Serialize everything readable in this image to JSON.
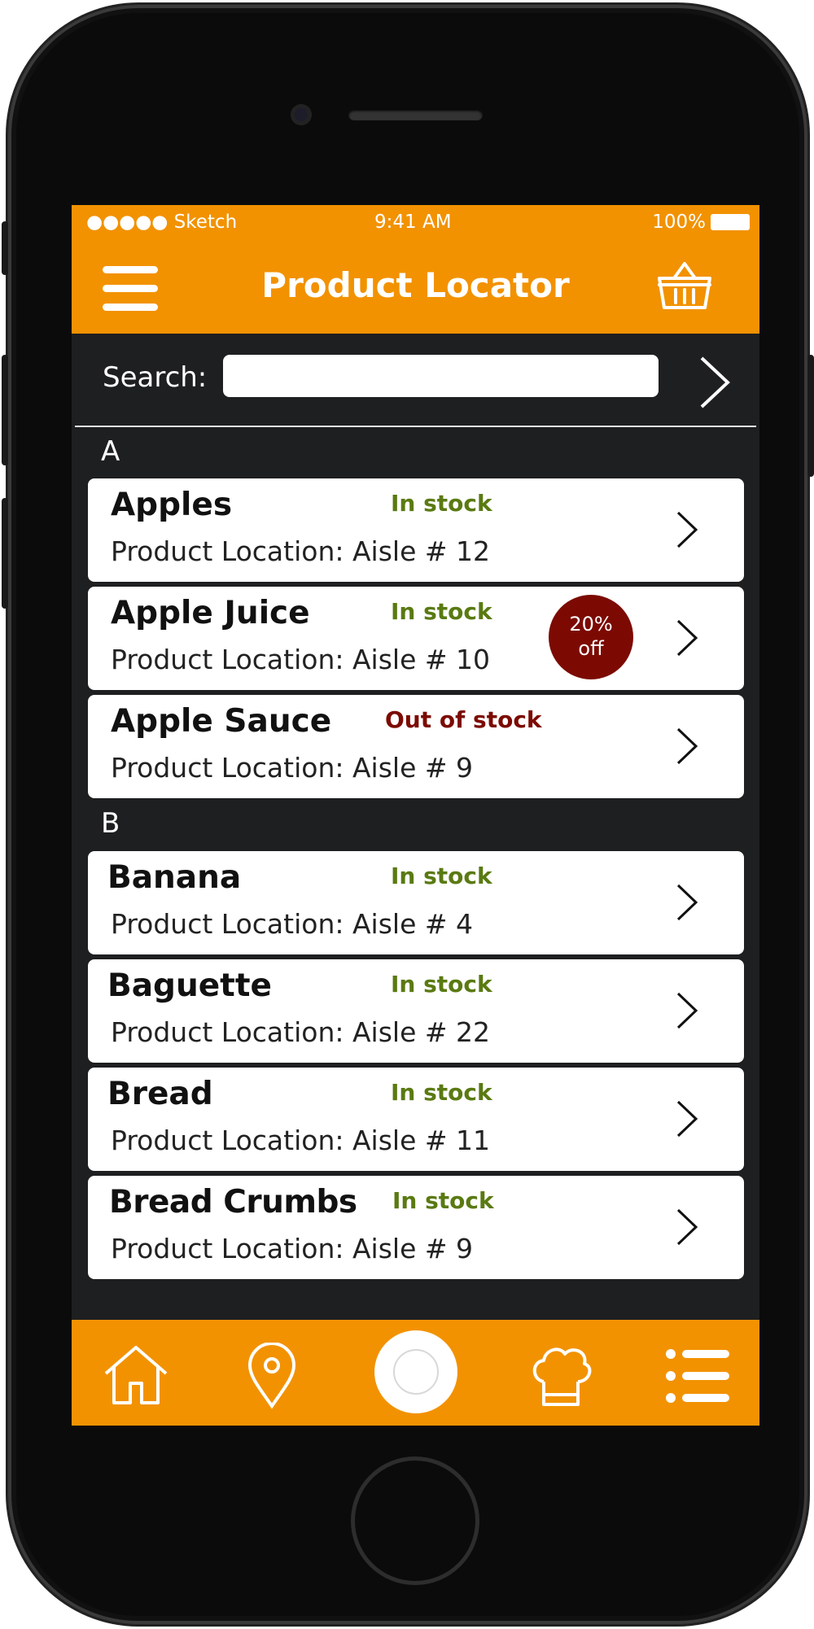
{
  "status_bar": {
    "carrier": "●●●●● Sketch",
    "time": "9:41 AM",
    "battery": "100%"
  },
  "header": {
    "title": "Product Locator",
    "menu_icon": "hamburger-menu-icon",
    "basket_icon": "basket-icon"
  },
  "search": {
    "label": "Search:",
    "value": "",
    "placeholder": ""
  },
  "sections": [
    {
      "letter": "A",
      "items": [
        {
          "name": "Apples",
          "stock": "In stock",
          "location": "Product Location: Aisle # 12"
        },
        {
          "name": "Apple Juice",
          "stock": "In stock",
          "location": "Product Location: Aisle # 10",
          "badge": {
            "line1": "20%",
            "line2": "off"
          }
        },
        {
          "name": "Apple Sauce",
          "stock": "Out of stock",
          "location": "Product Location: Aisle # 9"
        }
      ]
    },
    {
      "letter": "B",
      "items": [
        {
          "name": "Banana",
          "stock": "In stock",
          "location": "Product Location: Aisle # 4"
        },
        {
          "name": "Baguette",
          "stock": "In stock",
          "location": "Product Location: Aisle # 22"
        },
        {
          "name": "Bread",
          "stock": "In stock",
          "location": "Product Location: Aisle # 11"
        },
        {
          "name": "Bread Crumbs",
          "stock": "In stock",
          "location": "Product Location: Aisle # 9"
        }
      ]
    }
  ],
  "bottom_nav": [
    "home-icon",
    "location-pin-icon",
    "center-action-button",
    "chef-hat-icon",
    "list-icon"
  ],
  "colors": {
    "accent": "#f29200",
    "background": "#1e1f21",
    "in_stock": "#5a7a12",
    "out_of_stock": "#7c0a02",
    "badge": "#7c0a02"
  }
}
